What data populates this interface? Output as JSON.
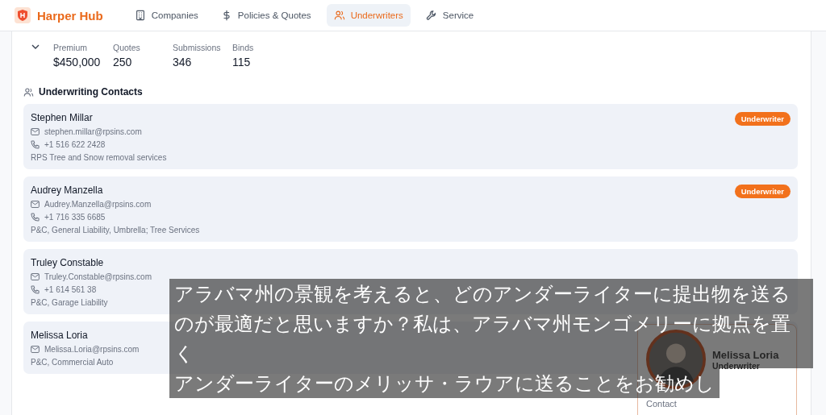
{
  "app": {
    "title": "Harper Hub"
  },
  "nav": [
    {
      "label": "Companies",
      "selected": false
    },
    {
      "label": "Policies & Quotes",
      "selected": false
    },
    {
      "label": "Underwriters",
      "selected": true
    },
    {
      "label": "Service",
      "selected": false
    }
  ],
  "stats": [
    {
      "label": "Premium",
      "value": "$450,000"
    },
    {
      "label": "Quotes",
      "value": "250"
    },
    {
      "label": "Submissions",
      "value": "346"
    },
    {
      "label": "Binds",
      "value": "115"
    }
  ],
  "contacts_section": {
    "title": "Underwriting Contacts"
  },
  "contacts": [
    {
      "name": "Stephen Millar",
      "email": "stephen.millar@rpsins.com",
      "phone": "+1 516 622 2428",
      "lines": "RPS Tree and Snow removal services",
      "badge": "Underwriter"
    },
    {
      "name": "Audrey Manzella",
      "email": "Audrey.Manzella@rpsins.com",
      "phone": "+1 716 335 6685",
      "lines": "P&C, General Liability, Umbrella; Tree Services",
      "badge": "Underwriter"
    },
    {
      "name": "Truley Constable",
      "email": "Truley.Constable@rpsins.com",
      "phone": "+1 614 561 38",
      "lines": "P&C, Garage Liability"
    },
    {
      "name": "Melissa Loria",
      "email": "Melissa.Loria@rpsins.com",
      "lines": "P&C, Commercial Auto"
    }
  ],
  "profile_popup": {
    "name": "Melissa Loria",
    "role": "Underwriter",
    "section": "Contact"
  },
  "subtitles": [
    [
      "アラバマ州の景観を考えると、どのアンダーライターに提出物を送る",
      "のが最適だと思いますか？私は、アラバマ州モンゴメリーに拠点を置",
      "く"
    ],
    [
      "アンダーライターのメリッサ・ラウアに送ることをお勧めし"
    ]
  ]
}
